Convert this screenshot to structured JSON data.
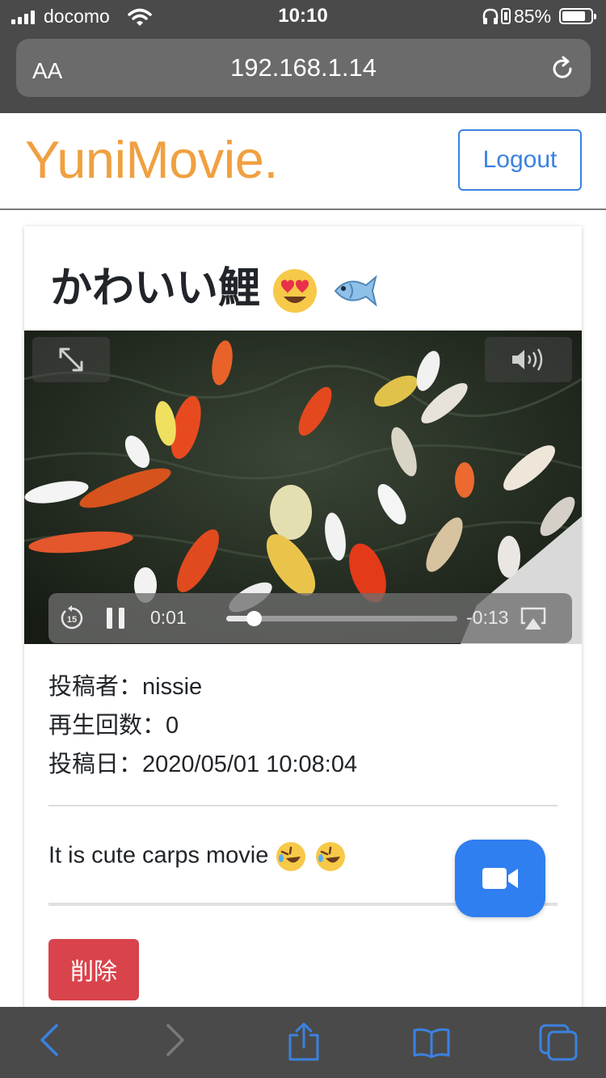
{
  "status_bar": {
    "carrier": "docomo",
    "time": "10:10",
    "battery_percent": "85%",
    "battery_level": 0.85
  },
  "browser": {
    "text_size_label": "AA",
    "url": "192.168.1.14"
  },
  "navbar": {
    "brand": "YuniMovie.",
    "brand_color": "#f0a040",
    "logout_label": "Logout"
  },
  "video": {
    "title": "かわいい鯉",
    "title_emojis": [
      "heart-eyes-emoji",
      "fish-emoji"
    ],
    "elapsed": "0:01",
    "remaining": "-0:13",
    "progress": 0.12,
    "state": "playing",
    "skip_back_seconds": "15"
  },
  "meta": {
    "uploader_label": "投稿者：",
    "uploader": "nissie",
    "views_label": "再生回数：",
    "views": "0",
    "date_label": "投稿日：",
    "date": "2020/05/01 10:08:04"
  },
  "description": {
    "text": "It is cute carps movie",
    "emojis": [
      "rolling-laughing-emoji",
      "rolling-laughing-emoji"
    ]
  },
  "actions": {
    "delete_label": "削除",
    "delete_color": "#d9434b",
    "upload_icon": "video-camera-icon",
    "upload_color": "#2f7ff0"
  },
  "toolbar": {
    "items": [
      "back-icon",
      "forward-icon",
      "share-icon",
      "bookmarks-icon",
      "tabs-icon"
    ]
  }
}
